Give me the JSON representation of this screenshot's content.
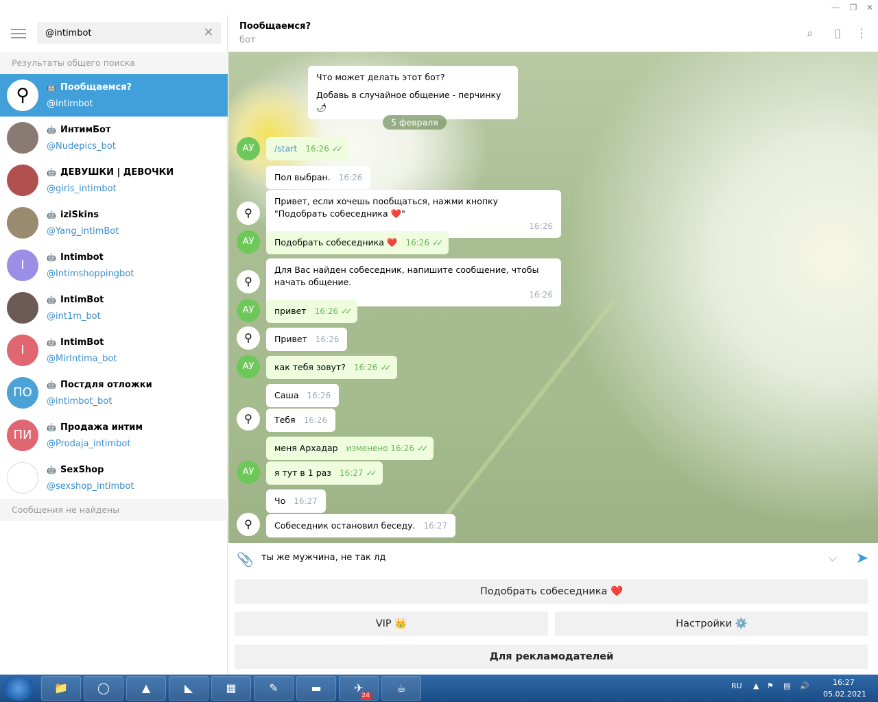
{
  "window": {
    "min": "—",
    "max": "❐",
    "close": "✕"
  },
  "search": {
    "value": "@intimbot"
  },
  "sidebar": {
    "global_results_label": "Результаты общего поиска",
    "no_messages_label": "Сообщения не найдены",
    "results": [
      {
        "name": "Пообщаемся?",
        "username": "@intimbot",
        "avatar_text": "",
        "avatar_color": "#ffffff",
        "active": true
      },
      {
        "name": "ИнтимБот",
        "username": "@Nudepics_bot",
        "avatar_text": "",
        "avatar_color": "#8a7b72"
      },
      {
        "name": "ДЕВУШКИ | ДЕВОЧКИ",
        "username": "@girls_intimbot",
        "avatar_text": "",
        "avatar_color": "#b0514f"
      },
      {
        "name": "iziSkins",
        "username": "@Yang_intimBot",
        "avatar_text": "",
        "avatar_color": "#9a8a70"
      },
      {
        "name": "Intimbot",
        "username": "@Intimshoppingbot",
        "avatar_text": "I",
        "avatar_color": "#9b8ee6"
      },
      {
        "name": "IntimBot",
        "username": "@int1m_bot",
        "avatar_text": "",
        "avatar_color": "#6b5a55"
      },
      {
        "name": "IntimBot",
        "username": "@MirIntima_bot",
        "avatar_text": "I",
        "avatar_color": "#e06672"
      },
      {
        "name": "Постдля отложки",
        "username": "@intimbot_bot",
        "avatar_text": "ПО",
        "avatar_color": "#4aa2d6"
      },
      {
        "name": "Продажа интим",
        "username": "@Prodaja_intimbot",
        "avatar_text": "ПИ",
        "avatar_color": "#e06672"
      },
      {
        "name": "SexShop",
        "username": "@sexshop_intimbot",
        "avatar_text": "",
        "avatar_color": "#ffffff"
      }
    ]
  },
  "chat": {
    "title": "Пообщаемся?",
    "status": "бот",
    "bot_info_title": "Что может делать этот бот?",
    "bot_info_text": "Добавь в случайное общение - перчинку 🌶",
    "date": "5 февраля",
    "avatar_user": "АУ",
    "messages": [
      {
        "text": "/start",
        "time": "16:26"
      },
      {
        "text": "Пол выбран.",
        "time": "16:26"
      },
      {
        "text": "Привет, если хочешь пообщаться, нажми кнопку \"Подобрать собеседника ❤️\"",
        "time": "16:26"
      },
      {
        "text": "Подобрать собеседника ❤️",
        "time": "16:26"
      },
      {
        "text": "Для Вас найден собеседник, напишите сообщение, чтобы начать общение.",
        "time": "16:26"
      },
      {
        "text": "привет",
        "time": "16:26"
      },
      {
        "text": "Привет",
        "time": "16:26"
      },
      {
        "text": "как тебя зовут?",
        "time": "16:26"
      },
      {
        "text": "Саша",
        "time": "16:26"
      },
      {
        "text": "Тебя",
        "time": "16:26"
      },
      {
        "text": "меня Архадар",
        "time": "изменено 16:26"
      },
      {
        "text": "я тут в 1 раз",
        "time": "16:27"
      },
      {
        "text": "Чо",
        "time": "16:27"
      },
      {
        "text": "Собеседник остановил беседу.",
        "time": "16:27"
      }
    ],
    "input_value": "ты же мужчина, не так лд",
    "keyboard": {
      "find": "Подобрать собеседника ❤️",
      "vip": "VIP 👑",
      "settings": "Настройки ⚙️",
      "ads": "Для рекламодателей"
    }
  },
  "taskbar": {
    "lang": "RU",
    "time": "16:27",
    "date": "05.02.2021",
    "telegram_badge": "24"
  },
  "colors": {
    "accent": "#419fd9",
    "outgoing": "#effdde",
    "link": "#3a8dcc"
  }
}
